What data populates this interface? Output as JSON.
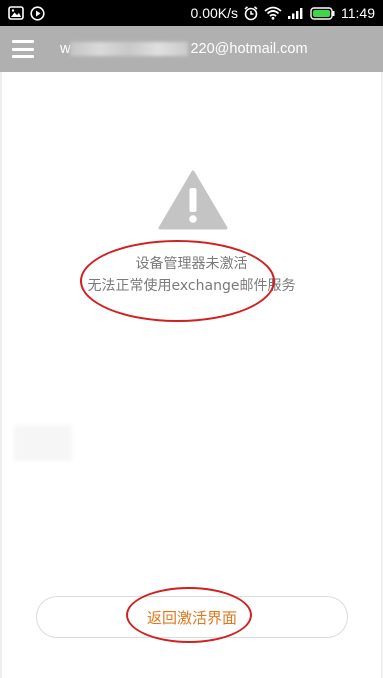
{
  "status_bar": {
    "speed": "0.00K/s",
    "time": "11:49",
    "icons": [
      "image-icon",
      "play-icon",
      "alarm-icon",
      "wifi-icon",
      "signal-icon",
      "battery-icon"
    ]
  },
  "app_bar": {
    "account_prefix": "w",
    "account_suffix": "220@hotmail.com"
  },
  "message": {
    "line1": "设备管理器未激活",
    "line2": "无法正常使用exchange邮件服务"
  },
  "action": {
    "return_label": "返回激活界面"
  },
  "colors": {
    "appbar": "#b0b0b0",
    "accent": "#e0781e",
    "annotation": "#d21f1f",
    "warning_icon": "#c4c4c4"
  }
}
